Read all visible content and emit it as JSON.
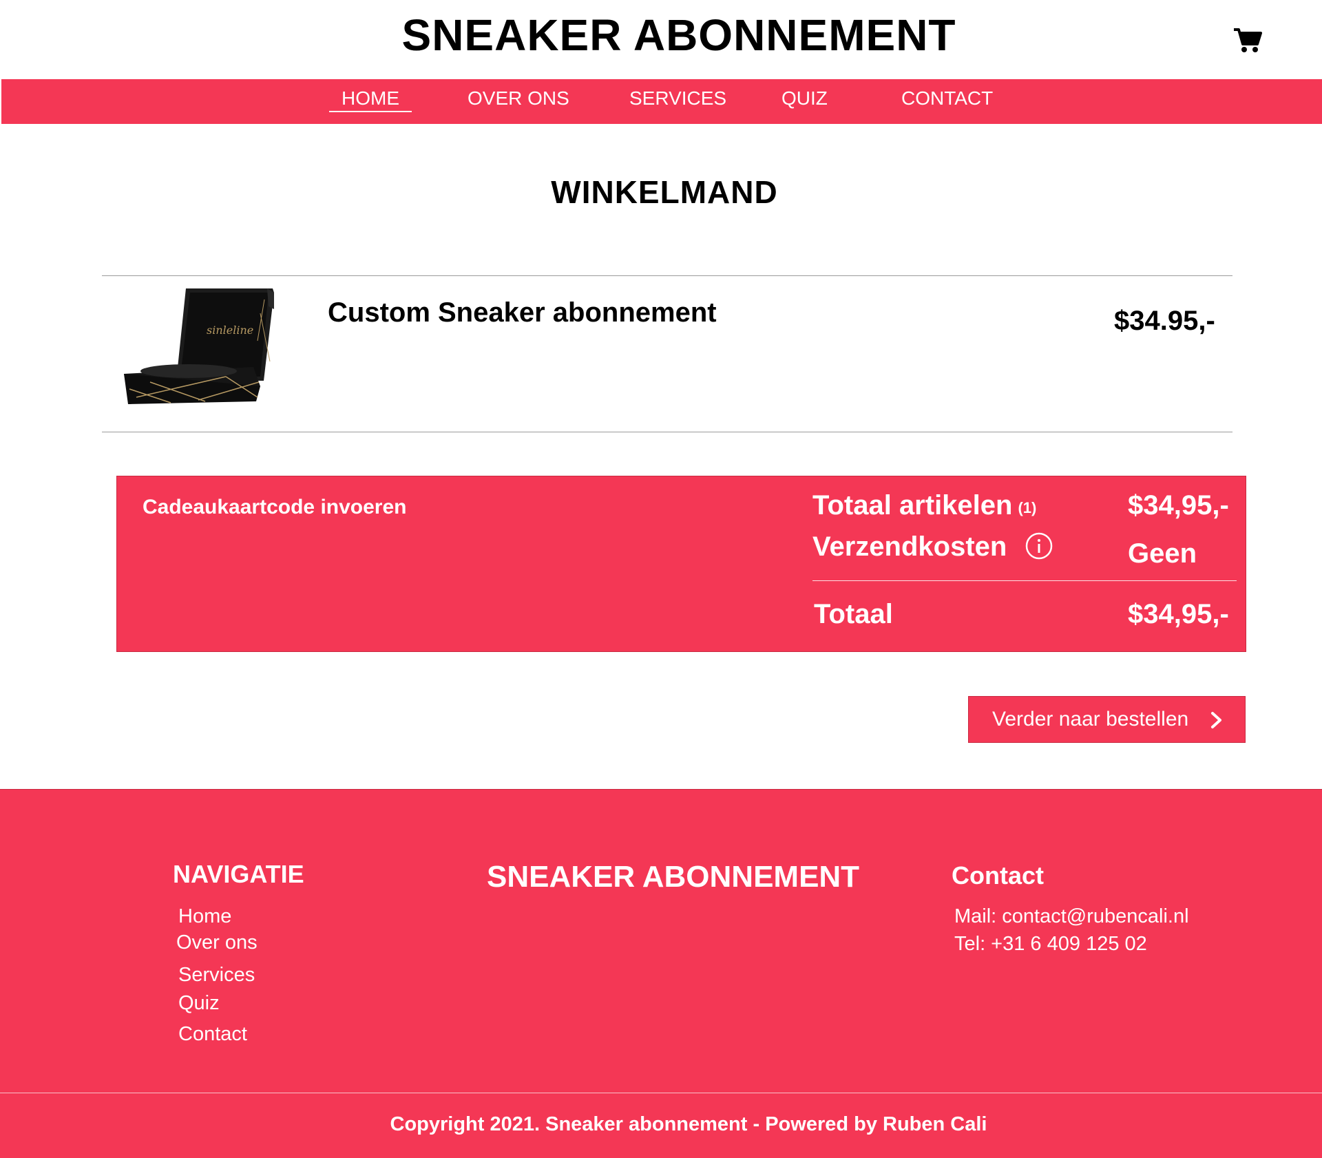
{
  "header": {
    "title": "SNEAKER ABONNEMENT",
    "cart_icon": "shopping-cart-icon"
  },
  "nav": {
    "items": [
      {
        "label": "HOME",
        "active": true
      },
      {
        "label": "OVER ONS",
        "active": false
      },
      {
        "label": "SERVICES",
        "active": false
      },
      {
        "label": "QUIZ",
        "active": false
      },
      {
        "label": "CONTACT",
        "active": false
      }
    ]
  },
  "main": {
    "heading": "WINKELMAND",
    "cart_items": [
      {
        "name": "Custom Sneaker abonnement",
        "price": "$34.95,-",
        "image_label": "sinleline"
      }
    ]
  },
  "summary": {
    "gift_code_label": "Cadeaukaartcode invoeren",
    "items_label": "Totaal artikelen",
    "items_count": "(1)",
    "items_value": "$34,95,-",
    "shipping_label": "Verzendkosten",
    "shipping_value": "Geen",
    "total_label": "Totaal",
    "total_value": "$34,95,-"
  },
  "actions": {
    "continue_label": "Verder naar bestellen"
  },
  "footer": {
    "nav_heading": "NAVIGATIE",
    "nav_links": [
      "Home",
      "Over ons",
      "Services",
      "Quiz",
      "Contact"
    ],
    "brand": "SNEAKER ABONNEMENT",
    "contact_heading": "Contact",
    "mail": "Mail: contact@rubencali.nl",
    "tel": "Tel: +31 6 409 125 02",
    "copyright": "Copyright 2021. Sneaker abonnement - Powered by Ruben Cali"
  },
  "colors": {
    "accent": "#f43755",
    "white": "#ffffff",
    "text": "#000000"
  }
}
